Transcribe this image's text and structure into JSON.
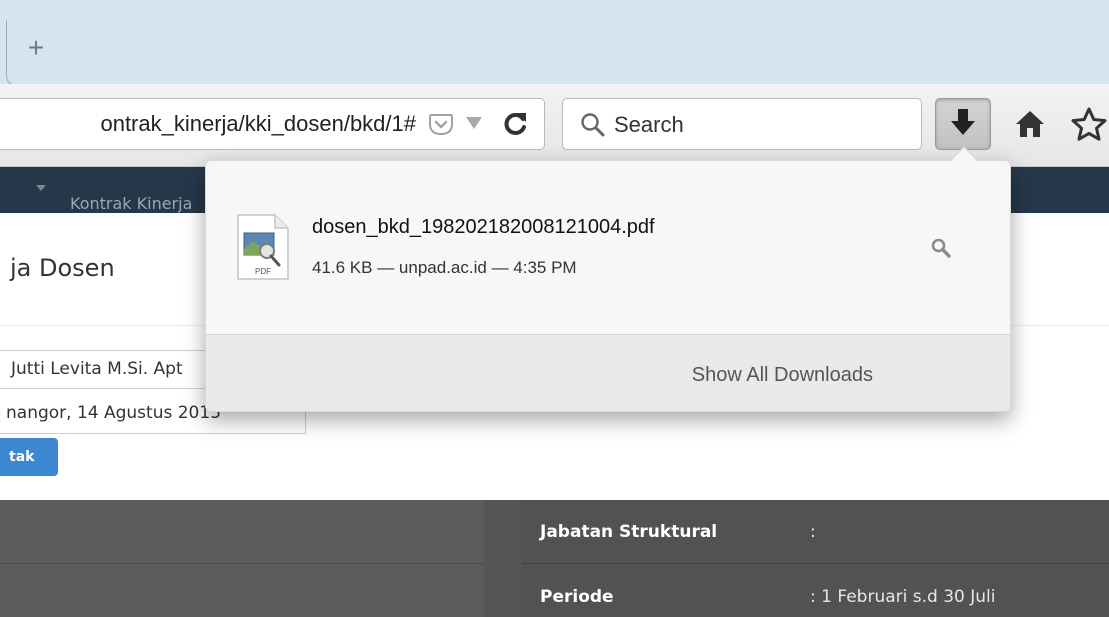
{
  "browser": {
    "new_tab_glyph": "+",
    "url": "ontrak_kinerja/kki_dosen/bkd/1#",
    "search_placeholder": "Search",
    "icons": [
      "new-tab-icon",
      "pocket-icon",
      "dropmarker-icon",
      "reload-icon",
      "search-icon",
      "download-icon",
      "home-icon",
      "bookmark-star-icon"
    ]
  },
  "downloads_panel": {
    "items": [
      {
        "file_name": "dosen_bkd_198202182008121004.pdf",
        "meta": "41.6 KB — unpad.ac.id — 4:35 PM",
        "file_type_label": "PDF",
        "icon": "pdf-file-icon"
      }
    ],
    "footer_label": "Show All Downloads"
  },
  "page": {
    "nav_item": "Kontrak Kinerja",
    "title": "ja Dosen",
    "name_field": "Jutti Levita M.Si. Apt",
    "date_field": "nangor, 14 Agustus 2015",
    "print_button": "tak",
    "table": [
      {
        "label": "Jabatan Struktural",
        "value": ":"
      },
      {
        "label": "Periode",
        "value": ": 1 Februari s.d 30 Juli"
      }
    ]
  },
  "colors": {
    "nav_bar": "#25384a",
    "print_button": "#3b88d0",
    "table_header": "#5c5c5c"
  }
}
